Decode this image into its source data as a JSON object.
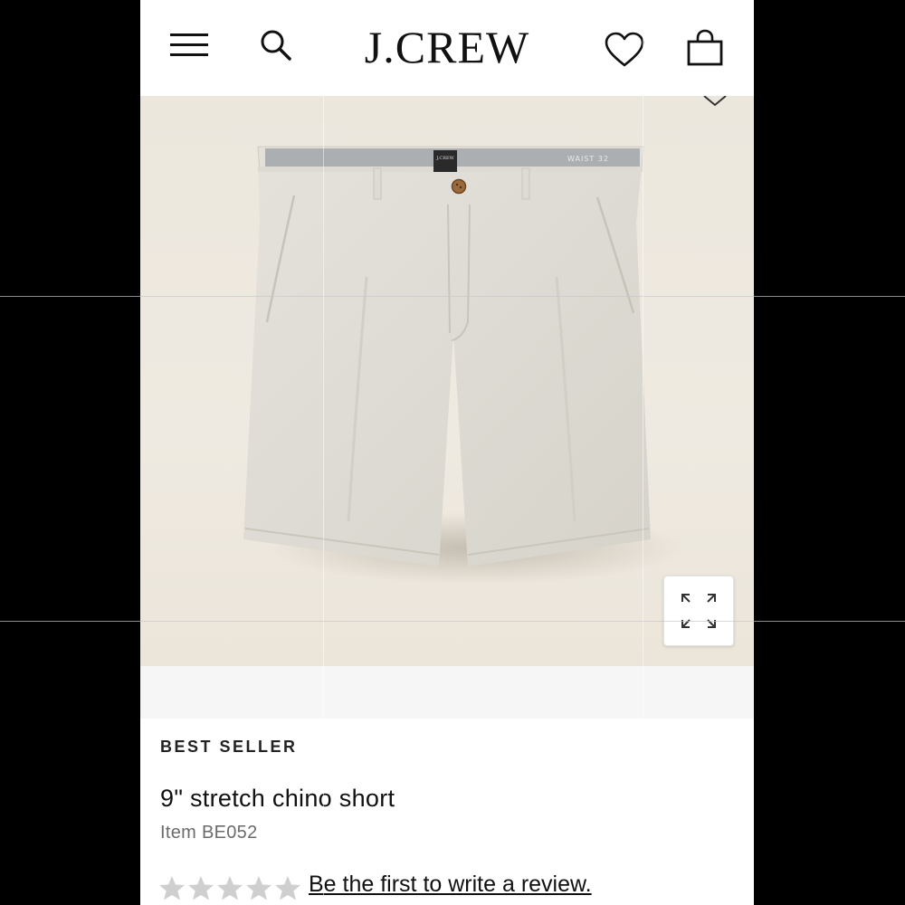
{
  "header": {
    "brand": "J.CREW",
    "icons": {
      "menu": "hamburger-menu-icon",
      "search": "search-icon",
      "wishlist": "heart-icon",
      "bag": "shopping-bag-icon"
    }
  },
  "product_image": {
    "label_tag": "J.CREW",
    "waist_tag": "WAIST 32",
    "zoom_icon": "expand-icon"
  },
  "product": {
    "badge": "BEST SELLER",
    "title": "9\" stretch chino short",
    "item_number": "Item BE052",
    "rating": {
      "stars_filled": 0,
      "stars_total": 5,
      "review_link": "Be the first to write a review."
    }
  },
  "colors": {
    "image_background": "#ece7dd",
    "shorts": "#e0ded6",
    "text": "#111111",
    "muted_text": "#6b6b6b",
    "star_empty": "#cfcfcf"
  }
}
